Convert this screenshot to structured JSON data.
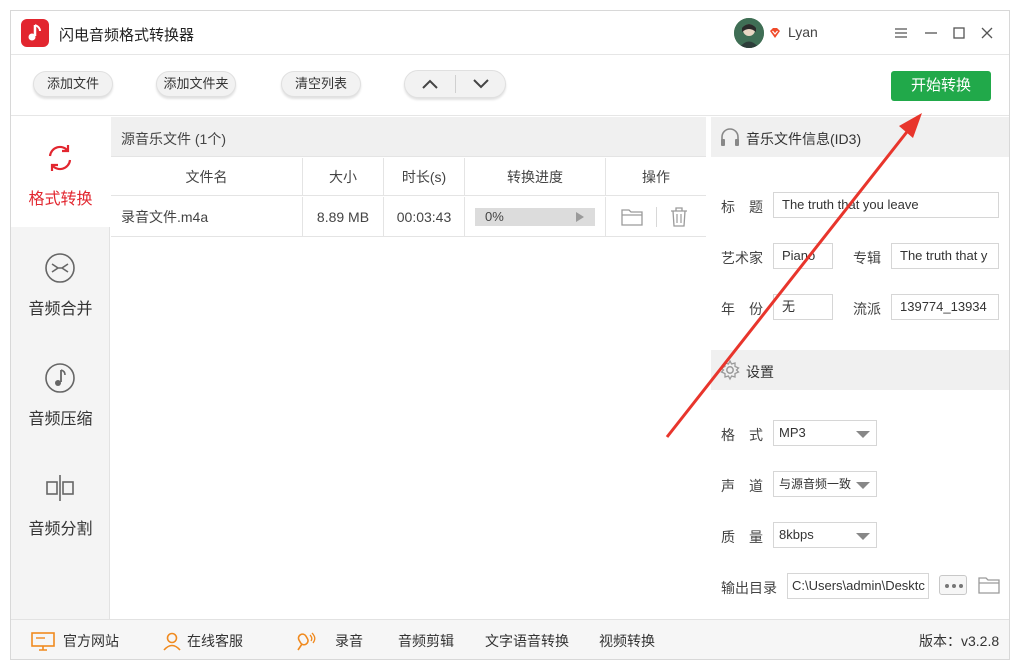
{
  "app": {
    "title": "闪电音频格式转换器",
    "user_name": "Lyan"
  },
  "colors": {
    "brand_red": "#e2262f",
    "start_green": "#21a94a",
    "annotation_red": "#e8352c"
  },
  "toolbar": {
    "add_file": "添加文件",
    "add_folder": "添加文件夹",
    "clear_list": "清空列表",
    "start": "开始转换"
  },
  "sidebar": {
    "items": [
      {
        "label": "格式转换",
        "icon": "refresh-icon",
        "active": true
      },
      {
        "label": "音频合并",
        "icon": "merge-icon",
        "active": false
      },
      {
        "label": "音频压缩",
        "icon": "music-note-icon",
        "active": false
      },
      {
        "label": "音频分割",
        "icon": "split-icon",
        "active": false
      }
    ]
  },
  "file_list": {
    "title": "源音乐文件 (1个)",
    "columns": [
      "文件名",
      "大小",
      "时长(s)",
      "转换进度",
      "操作"
    ],
    "rows": [
      {
        "name": "录音文件.m4a",
        "size": "8.89 MB",
        "duration": "00:03:43",
        "progress": "0%"
      }
    ]
  },
  "id3": {
    "title": "音乐文件信息(ID3)",
    "title_label": "标　题",
    "title_value": "The truth that you leave",
    "artist_label": "艺术家",
    "artist_value": "Piano",
    "album_label": "专辑",
    "album_value": "The truth that y",
    "year_label": "年　份",
    "year_value": "无",
    "genre_label": "流派",
    "genre_value": "139774_13934"
  },
  "settings": {
    "title": "设置",
    "format_label": "格　式",
    "format_value": "MP3",
    "channel_label": "声　道",
    "channel_value": "与源音频一致",
    "quality_label": "质　量",
    "quality_value": "8kbps",
    "output_label": "输出目录",
    "output_value": "C:\\Users\\admin\\Desktc"
  },
  "footer": {
    "website": "官方网站",
    "support": "在线客服",
    "record": "录音",
    "audio_edit": "音频剪辑",
    "tts": "文字语音转换",
    "video_convert": "视频转换",
    "version": "版本：v3.2.8"
  }
}
